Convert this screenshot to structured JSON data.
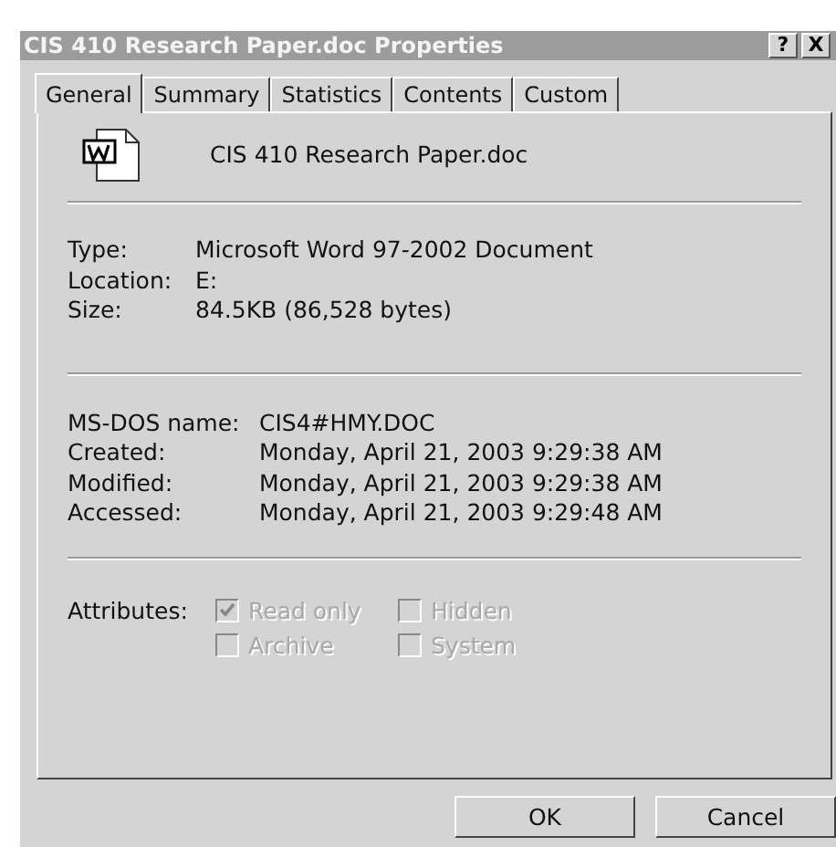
{
  "window": {
    "title": "CIS 410 Research Paper.doc Properties",
    "title_buttons": [
      "?",
      "X"
    ]
  },
  "tabs": [
    {
      "label": "General",
      "selected": true
    },
    {
      "label": "Summary",
      "selected": false
    },
    {
      "label": "Statistics",
      "selected": false
    },
    {
      "label": "Contents",
      "selected": false
    },
    {
      "label": "Custom",
      "selected": false
    }
  ],
  "file_name": "CIS 410 Research Paper.doc",
  "sections": [
    [
      {
        "label": "Type:",
        "value": "Microsoft Word 97-2002 Document"
      },
      {
        "label": "Location:",
        "value": "E:"
      },
      {
        "label": "Size:",
        "value": "84.5KB (86,528 bytes)"
      }
    ],
    [
      {
        "label": "MS-DOS name:",
        "value": "CIS4#HMY.DOC"
      },
      {
        "label": "Created:",
        "value": "Monday, April 21, 2003 9:29:38 AM"
      },
      {
        "label": "Modified:",
        "value": "Monday, April 21, 2003 9:29:38 AM"
      },
      {
        "label": "Accessed:",
        "value": "Monday, April 21, 2003 9:29:48 AM"
      }
    ]
  ],
  "attributes": {
    "label": "Attributes:",
    "items": [
      {
        "label": "Read only",
        "checked": true,
        "disabled": true
      },
      {
        "label": "Hidden",
        "checked": false,
        "disabled": true
      },
      {
        "label": "Archive",
        "checked": false,
        "disabled": true
      },
      {
        "label": "System",
        "checked": false,
        "disabled": true
      }
    ]
  },
  "buttons": [
    "OK",
    "Cancel"
  ]
}
